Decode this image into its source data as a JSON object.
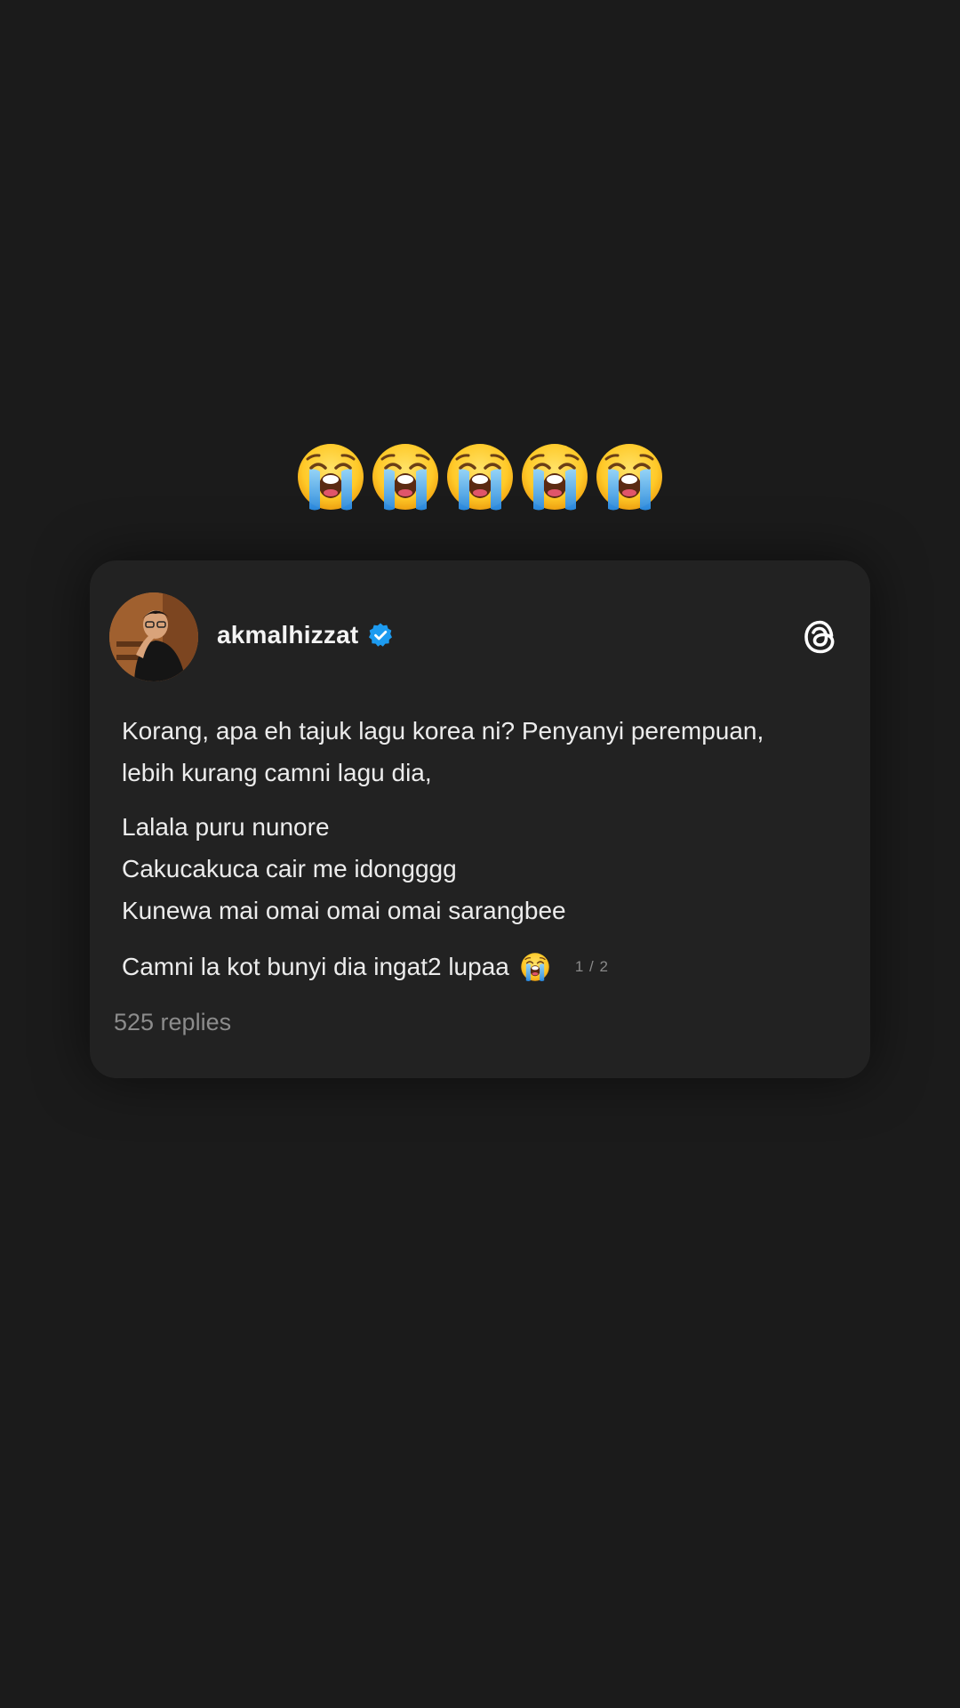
{
  "emoji_row": {
    "count": 5,
    "icon": "loudly-crying-face-icon"
  },
  "post": {
    "username": "akmalhizzat",
    "verified": true,
    "lines_para1": [
      "Korang, apa eh tajuk lagu korea ni? Penyanyi perempuan,",
      "lebih kurang camni lagu dia,"
    ],
    "lines_para2": [
      "Lalala puru nunore",
      "Cakucakuca cair me idongggg",
      "Kunewa mai omai omai omai sarangbee"
    ],
    "last_line": "Camni la kot bunyi dia ingat2 lupaa",
    "page_counter": "1 / 2",
    "replies": "525 replies"
  },
  "colors": {
    "background": "#1b1b1b",
    "card": "#222222",
    "verified_blue": "#1d9bf0",
    "text": "#ececec",
    "muted": "#8c8c8c"
  }
}
